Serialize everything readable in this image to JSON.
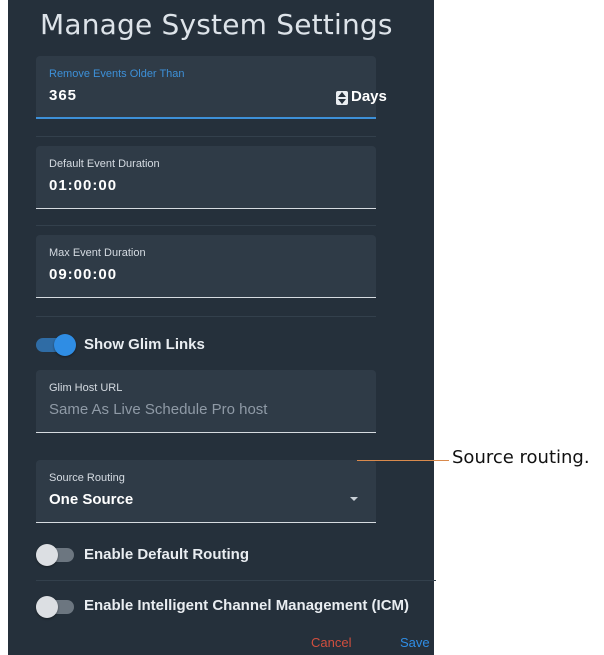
{
  "dialog": {
    "title": "Manage System Settings",
    "remove_events": {
      "label": "Remove Events Older Than",
      "value": "365",
      "unit": "Days"
    },
    "default_duration": {
      "label": "Default Event Duration",
      "value": "01:00:00"
    },
    "max_duration": {
      "label": "Max Event Duration",
      "value": "09:00:00"
    },
    "show_glim_links": {
      "label": "Show Glim Links",
      "checked": true
    },
    "glim_host_url": {
      "label": "Glim Host URL",
      "placeholder": "Same As Live Schedule Pro host"
    },
    "source_routing": {
      "label": "Source Routing",
      "value": "One Source"
    },
    "enable_default_routing": {
      "label": "Enable Default Routing",
      "checked": false
    },
    "enable_icm": {
      "label": "Enable Intelligent Channel Management (ICM)",
      "checked": false
    },
    "cancel_label": "Cancel",
    "save_label": "Save"
  },
  "annotation": {
    "text": "Source routing."
  },
  "colors": {
    "dialog_bg": "#25303b",
    "field_bg": "#2f3b47",
    "accent_blue": "#2f8de4",
    "cancel_red": "#d04e3e",
    "callout_line": "#d98a4d"
  }
}
